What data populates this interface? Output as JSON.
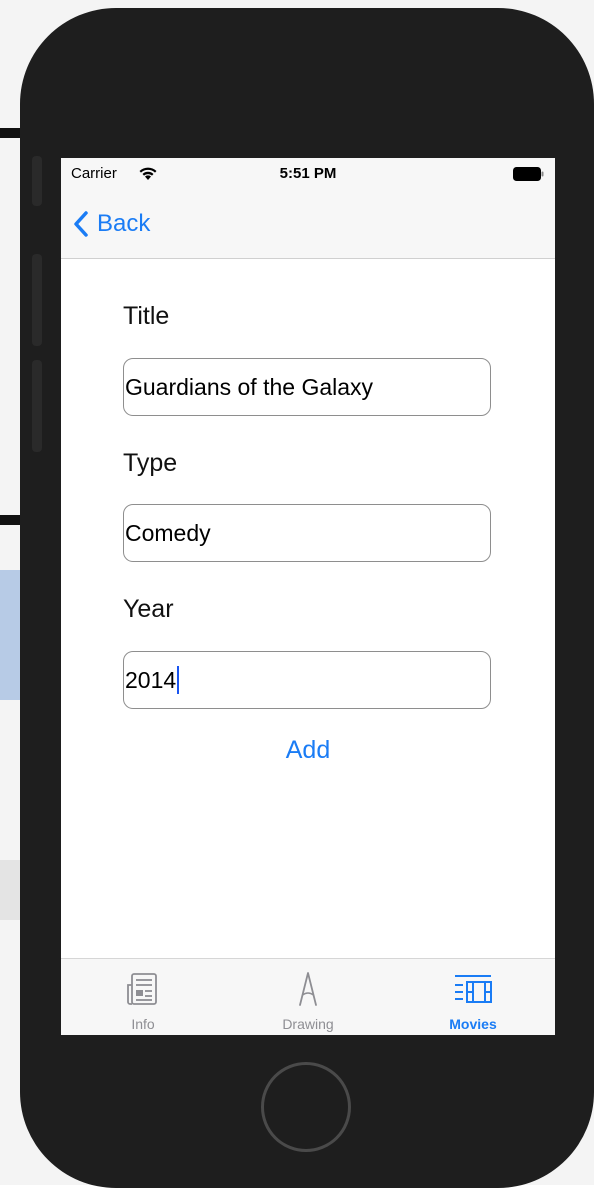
{
  "status_bar": {
    "carrier": "Carrier",
    "time": "5:51 PM"
  },
  "nav": {
    "back_label": "Back"
  },
  "form": {
    "title_label": "Title",
    "title_value": "Guardians of the Galaxy",
    "type_label": "Type",
    "type_value": "Comedy",
    "year_label": "Year",
    "year_value": "2014",
    "add_label": "Add"
  },
  "tab_bar": {
    "tabs": [
      {
        "label": "Info",
        "icon": "newspaper-icon",
        "active": false
      },
      {
        "label": "Drawing",
        "icon": "compass-drawing-icon",
        "active": false
      },
      {
        "label": "Movies",
        "icon": "film-list-icon",
        "active": true
      }
    ]
  },
  "colors": {
    "accent": "#1a7cf5",
    "inactive": "#8e8e93",
    "device_frame": "#1e1e1e"
  }
}
